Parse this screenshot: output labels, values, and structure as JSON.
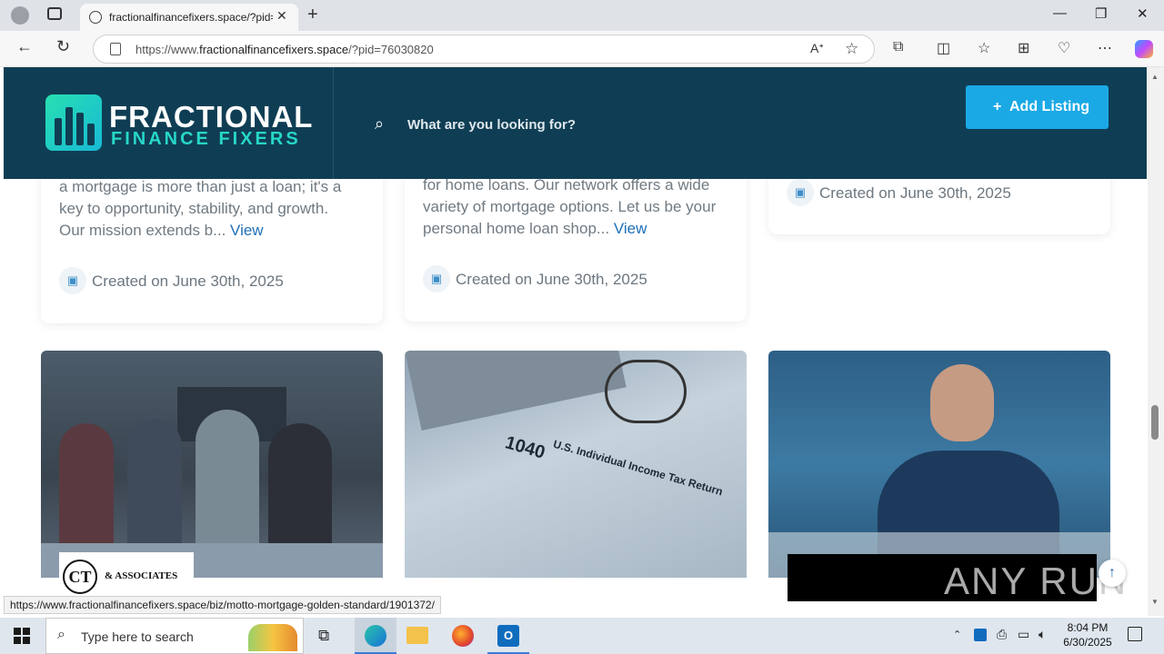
{
  "browser": {
    "tab_title": "fractionalfinancefixers.space/?pid=",
    "url_prefix": "https://www.",
    "url_host": "fractionalfinancefixers.space",
    "url_rest": "/?pid=76030820",
    "status_link": "https://www.fractionalfinancefixers.space/biz/motto-mortgage-golden-standard/1901372/"
  },
  "header": {
    "logo_top": "FRACTIONAL",
    "logo_bottom": "FINANCE FIXERS",
    "search_placeholder": "What are you looking for?",
    "add_listing": "Add Listing"
  },
  "cards": [
    {
      "lines": [
        "a mortgage is more than just a loan; it's a",
        "key to opportunity, stability, and growth.",
        "Our mission extends b..."
      ],
      "view": "View",
      "created": "Created on June 30th, 2025"
    },
    {
      "lines": [
        "for home loans. Our network offers a wide",
        "variety of mortgage options. Let us be your",
        "personal home loan shop..."
      ],
      "view": "View",
      "created": "Created on June 30th, 2025"
    },
    {
      "lines": [],
      "view": "",
      "created": "Created on June 30th, 2025"
    }
  ],
  "photos": {
    "badge_initials": "CT",
    "badge_text": "& ASSOCIATES",
    "form_number": "1040",
    "form_title": "U.S. Individual Income Tax Return",
    "watermark": "ANY RUN"
  },
  "taskbar": {
    "search_placeholder": "Type here to search",
    "time": "8:04 PM",
    "date": "6/30/2025"
  }
}
